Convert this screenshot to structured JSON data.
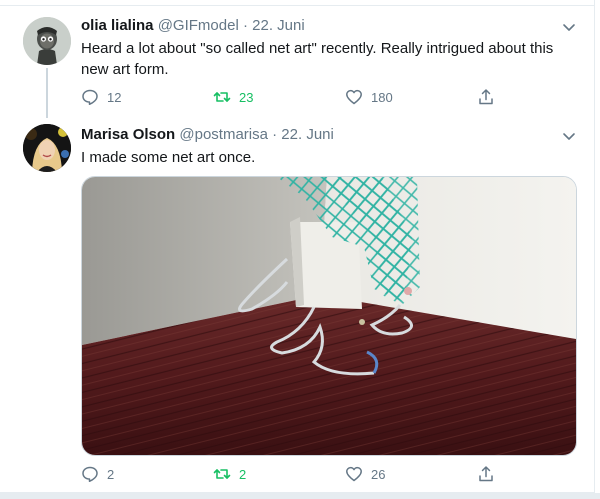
{
  "tweets": [
    {
      "name": "olia lialina",
      "handle": "@GIFmodel",
      "date": "· 22. Juni",
      "text_line1": "Heard a lot about \"so called net art\" recently. Really intrigued about this",
      "text_line2": "new art form.",
      "replies": "12",
      "retweets": "23",
      "likes": "180"
    },
    {
      "name": "Marisa Olson",
      "handle": "@postmarisa",
      "date": "· 22. Juni",
      "text": "I made some net art once.",
      "replies": "2",
      "retweets": "2",
      "likes": "26"
    }
  ],
  "icons": {
    "reply": "reply-icon",
    "retweet": "retweet-icon",
    "like": "heart-icon",
    "share": "share-icon",
    "menu": "chevron-down-icon"
  },
  "colors": {
    "text": "#14171a",
    "muted": "#657786",
    "retweet_active": "#17bf63",
    "border": "#e6ecf0"
  }
}
